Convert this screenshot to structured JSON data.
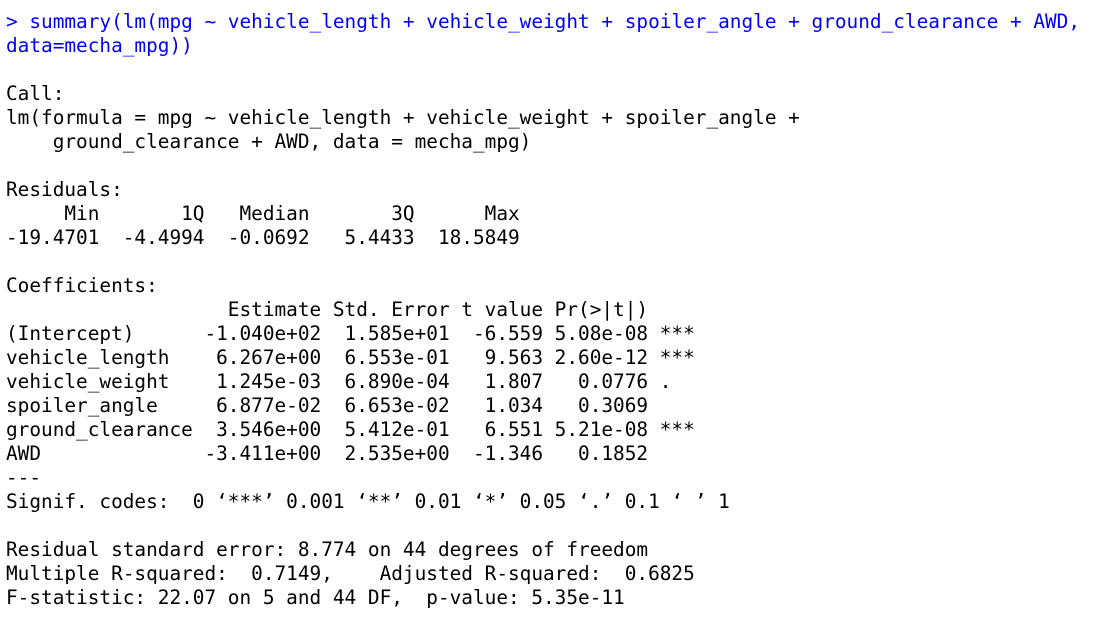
{
  "console": {
    "command_lines": [
      "> summary(lm(mpg ~ vehicle_length + vehicle_weight + spoiler_angle + ground_clearance + AWD,",
      "data=mecha_mpg))"
    ],
    "colors": {
      "command_text": "#0000ff",
      "output_text": "#000000",
      "background": "#ffffff"
    },
    "call": {
      "header": "Call:",
      "lines": [
        "lm(formula = mpg ~ vehicle_length + vehicle_weight + spoiler_angle +",
        "    ground_clearance + AWD, data = mecha_mpg)"
      ]
    },
    "residuals": {
      "header": "Residuals:",
      "labels_line": "     Min       1Q   Median       3Q      Max ",
      "values_line": "-19.4701  -4.4994  -0.0692   5.4433  18.5849 "
    },
    "coefficients": {
      "header": "Coefficients:",
      "column_header_line": "                   Estimate Std. Error t value Pr(>|t|)    ",
      "rows": [
        "(Intercept)      -1.040e+02  1.585e+01  -6.559 5.08e-08 ***",
        "vehicle_length    6.267e+00  6.553e-01   9.563 2.60e-12 ***",
        "vehicle_weight    1.245e-03  6.890e-04   1.807   0.0776 .  ",
        "spoiler_angle     6.877e-02  6.653e-02   1.034   0.3069    ",
        "ground_clearance  3.546e+00  5.412e-01   6.551 5.21e-08 ***",
        "AWD              -3.411e+00  2.535e+00  -1.346   0.1852    "
      ],
      "separator": "---",
      "signif_codes": "Signif. codes:  0 ‘***’ 0.001 ‘**’ 0.01 ‘*’ 0.05 ‘.’ 0.1 ‘ ’ 1"
    },
    "summary_stats": [
      "Residual standard error: 8.774 on 44 degrees of freedom",
      "Multiple R-squared:  0.7149,\tAdjusted R-squared:  0.6825 ",
      "F-statistic: 22.07 on 5 and 44 DF,  p-value: 5.35e-11"
    ]
  }
}
